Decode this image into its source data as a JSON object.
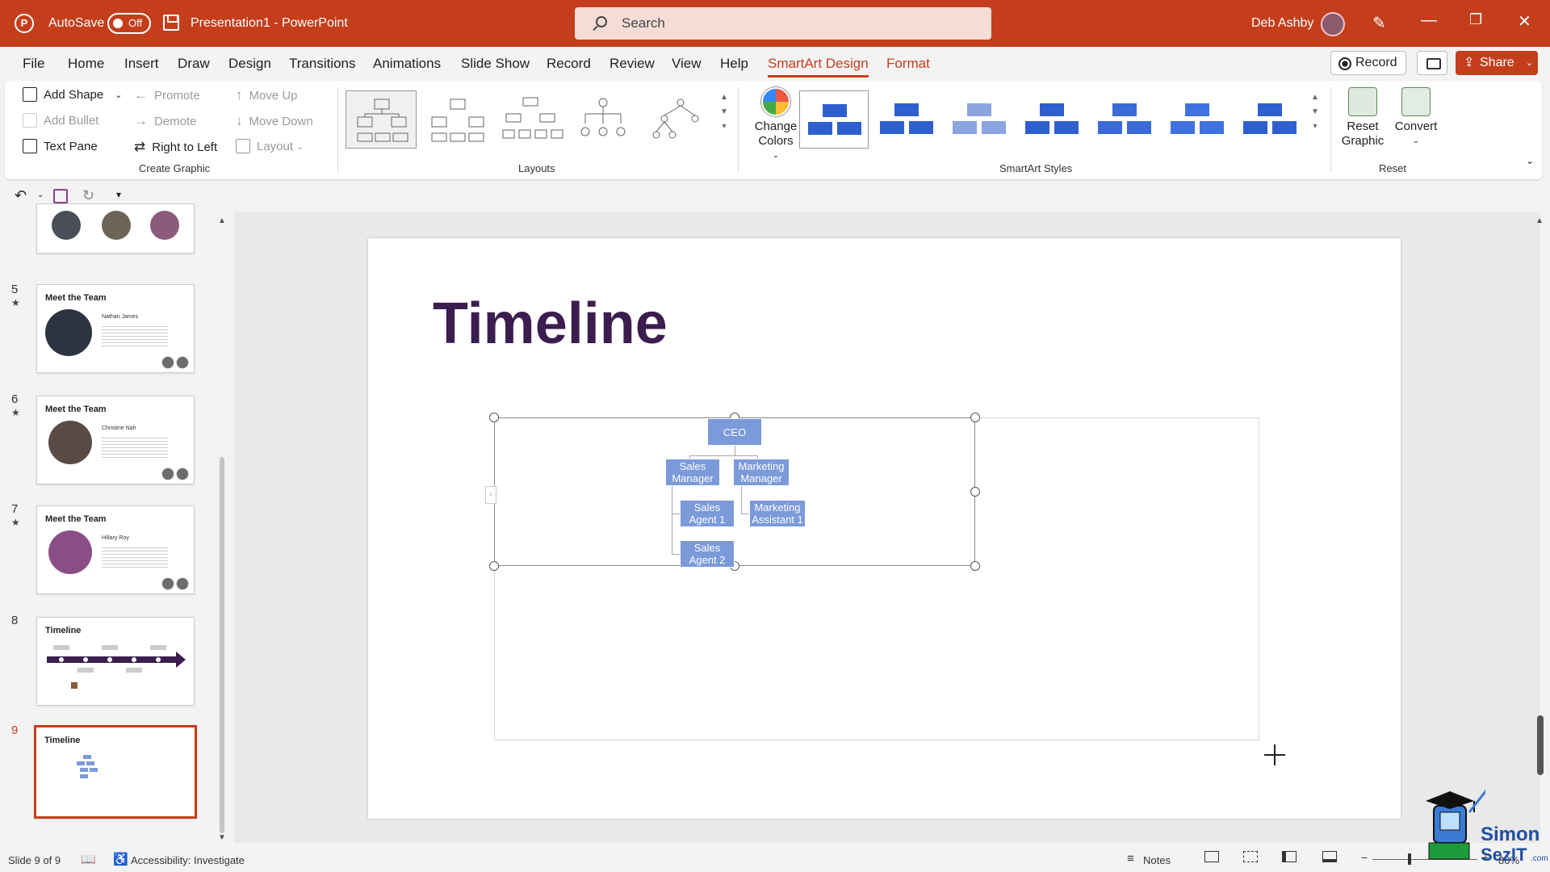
{
  "titlebar": {
    "app_logo": "P",
    "autosave_label": "AutoSave",
    "autosave_state": "Off",
    "document_title": "Presentation1 - PowerPoint",
    "search_placeholder": "Search",
    "user_name": "Deb Ashby"
  },
  "tabs": [
    "File",
    "Home",
    "Insert",
    "Draw",
    "Design",
    "Transitions",
    "Animations",
    "Slide Show",
    "Record",
    "Review",
    "View",
    "Help",
    "SmartArt Design",
    "Format"
  ],
  "active_tab": "SmartArt Design",
  "right_buttons": {
    "record": "Record",
    "share": "Share"
  },
  "ribbon": {
    "create_graphic": {
      "label": "Create Graphic",
      "add_shape": "Add Shape",
      "add_bullet": "Add Bullet",
      "text_pane": "Text Pane",
      "promote": "Promote",
      "demote": "Demote",
      "right_to_left": "Right to Left",
      "move_up": "Move Up",
      "move_down": "Move Down",
      "layout": "Layout"
    },
    "layouts": {
      "label": "Layouts"
    },
    "change_colors": "Change Colors",
    "smartart_styles": {
      "label": "SmartArt Styles"
    },
    "reset": {
      "label": "Reset",
      "reset_graphic": "Reset Graphic",
      "convert": "Convert"
    }
  },
  "slides": [
    {
      "number": "5",
      "title": "Meet the Team",
      "name": "Nathan James"
    },
    {
      "number": "6",
      "title": "Meet the Team",
      "name": "Christine Nah"
    },
    {
      "number": "7",
      "title": "Meet the Team",
      "name": "Hillary Roy"
    },
    {
      "number": "8",
      "title": "Timeline"
    },
    {
      "number": "9",
      "title": "Timeline"
    }
  ],
  "current_slide": {
    "title": "Timeline",
    "org_chart": {
      "ceo": "CEO",
      "sales_manager": "Sales Manager",
      "marketing_manager": "Marketing Manager",
      "sales_agent_1": "Sales Agent 1",
      "sales_agent_2": "Sales Agent 2",
      "marketing_assistant_1": "Marketing Assistant 1"
    }
  },
  "statusbar": {
    "slide_counter": "Slide 9 of 9",
    "accessibility": "Accessibility: Investigate",
    "notes": "Notes",
    "zoom": "80%"
  },
  "watermark": {
    "brand": "Simon",
    "brand2": "SezIT",
    "brand3": ".com"
  },
  "colors": {
    "accent": "#c43e1c",
    "title_purple": "#3b1d4f",
    "node_blue": "#7b9ad9",
    "style_blue": "#2f5fcf"
  }
}
